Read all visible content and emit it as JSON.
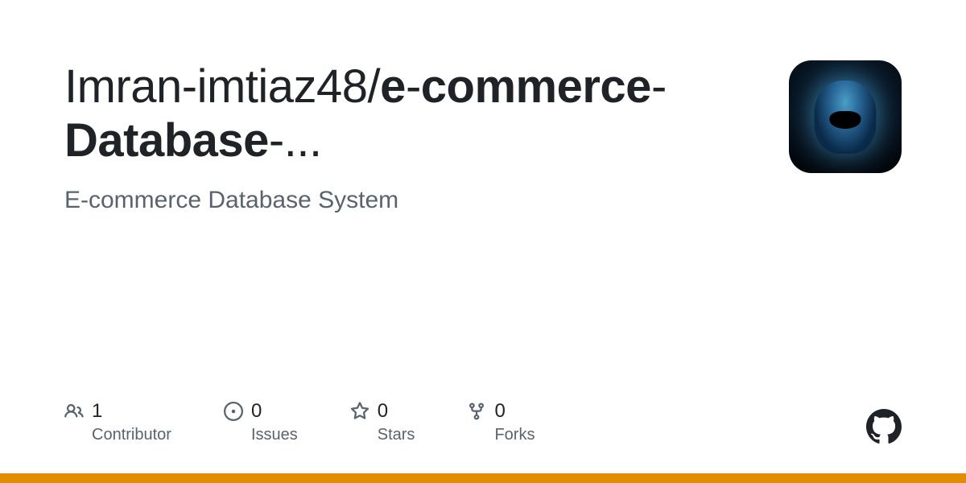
{
  "repo": {
    "owner": "Imran-imtiaz48",
    "name_part1": "e",
    "name_part2": "commerce",
    "name_part3": "Database",
    "ellipsis": "...",
    "description": "E-commerce Database System"
  },
  "stats": {
    "contributors": {
      "count": "1",
      "label": "Contributor"
    },
    "issues": {
      "count": "0",
      "label": "Issues"
    },
    "stars": {
      "count": "0",
      "label": "Stars"
    },
    "forks": {
      "count": "0",
      "label": "Forks"
    }
  }
}
